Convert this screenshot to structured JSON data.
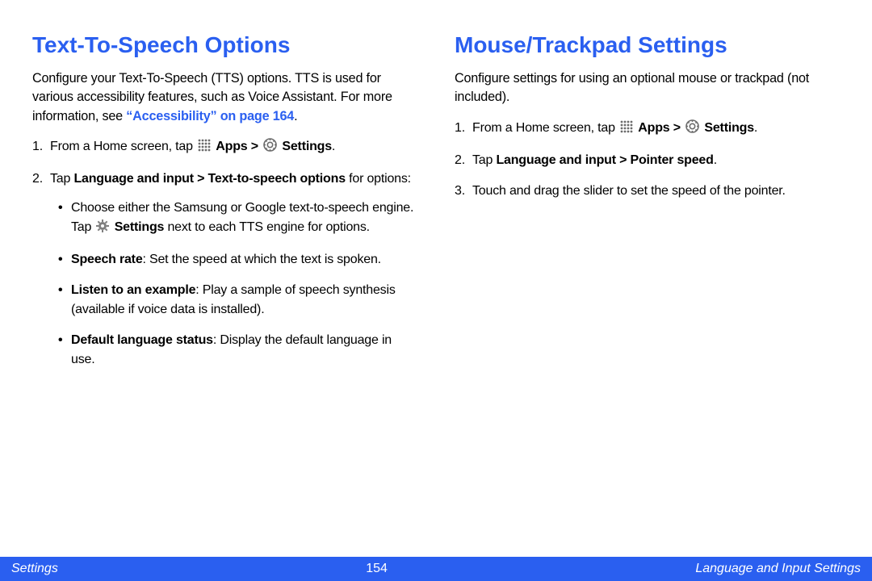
{
  "left": {
    "heading": "Text-To-Speech Options",
    "intro_pre": "Configure your Text-To-Speech (TTS) options. TTS is used for various accessibility features, such as Voice Assistant. For more information, see ",
    "intro_link": "“Accessibility” on page 164",
    "intro_post": ".",
    "step1_pre": "From a Home screen, tap ",
    "apps_label": "Apps > ",
    "settings_label": "Settings",
    "step1_post": ".",
    "step2_pre": "Tap ",
    "step2_bold": "Language and input > Text-to-speech options",
    "step2_mid": " for options:",
    "bullet1_a": "Choose either the Samsung or Google text‑to‑speech engine. Tap ",
    "bullet1_settings": "Settings",
    "bullet1_b": " next to each TTS engine for options.",
    "bullet2_label": "Speech rate",
    "bullet2_text": ": Set the speed at which the text is spoken.",
    "bullet3_label": "Listen to an example",
    "bullet3_text": ": Play a sample of speech synthesis (available if voice data is installed).",
    "bullet4_label": "Default language status",
    "bullet4_text": ": Display the default language in use."
  },
  "right": {
    "heading": "Mouse/Trackpad Settings",
    "intro": "Configure settings for using an optional mouse or trackpad (not included).",
    "step1_pre": "From a Home screen, tap ",
    "apps_label": "Apps > ",
    "settings_label": "Settings",
    "step1_post": ".",
    "step2_pre": "Tap ",
    "step2_bold": "Language and input > Pointer speed",
    "step2_post": ".",
    "step3": "Touch and drag the slider to set the speed of the pointer."
  },
  "footer": {
    "left": "Settings",
    "page": "154",
    "right": "Language and Input Settings"
  }
}
